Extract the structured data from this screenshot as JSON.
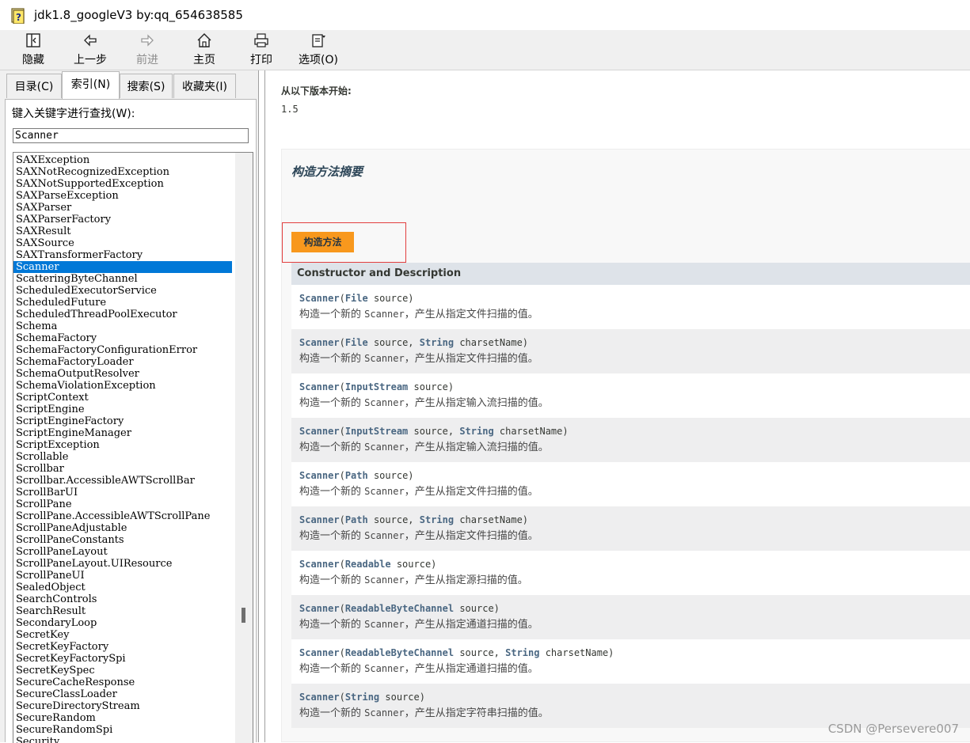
{
  "window": {
    "title": "jdk1.8_googleV3 by:qq_654638585"
  },
  "toolbar": {
    "hide": "隐藏",
    "back": "上一步",
    "forward": "前进",
    "home": "主页",
    "print": "打印",
    "options": "选项(O)"
  },
  "tabs": {
    "contents": "目录(C)",
    "index": "索引(N)",
    "search": "搜索(S)",
    "favorites": "收藏夹(I)"
  },
  "index_panel": {
    "search_label": "键入关键字进行查找(W):",
    "search_value": "Scanner",
    "selected": "Scanner",
    "items": [
      "SAXException",
      "SAXNotRecognizedException",
      "SAXNotSupportedException",
      "SAXParseException",
      "SAXParser",
      "SAXParserFactory",
      "SAXResult",
      "SAXSource",
      "SAXTransformerFactory",
      "Scanner",
      "ScatteringByteChannel",
      "ScheduledExecutorService",
      "ScheduledFuture",
      "ScheduledThreadPoolExecutor",
      "Schema",
      "SchemaFactory",
      "SchemaFactoryConfigurationError",
      "SchemaFactoryLoader",
      "SchemaOutputResolver",
      "SchemaViolationException",
      "ScriptContext",
      "ScriptEngine",
      "ScriptEngineFactory",
      "ScriptEngineManager",
      "ScriptException",
      "Scrollable",
      "Scrollbar",
      "Scrollbar.AccessibleAWTScrollBar",
      "ScrollBarUI",
      "ScrollPane",
      "ScrollPane.AccessibleAWTScrollPane",
      "ScrollPaneAdjustable",
      "ScrollPaneConstants",
      "ScrollPaneLayout",
      "ScrollPaneLayout.UIResource",
      "ScrollPaneUI",
      "SealedObject",
      "SearchControls",
      "SearchResult",
      "SecondaryLoop",
      "SecretKey",
      "SecretKeyFactory",
      "SecretKeyFactorySpi",
      "SecretKeySpec",
      "SecureCacheResponse",
      "SecureClassLoader",
      "SecureDirectoryStream",
      "SecureRandom",
      "SecureRandomSpi",
      "Security"
    ]
  },
  "content": {
    "since_label": "从以下版本开始:",
    "since_value": "1.5",
    "section_title": "构造方法摘要",
    "caption": "构造方法",
    "table_header": "Constructor and Description",
    "rows": [
      {
        "name": "Scanner",
        "open": "(",
        "type1": "File",
        "rest1": " source)",
        "type2": "",
        "rest2": "",
        "desc_pre": "构造一个新的 ",
        "desc_code": "Scanner",
        "desc_post": "，产生从指定文件扫描的值。"
      },
      {
        "name": "Scanner",
        "open": "(",
        "type1": "File",
        "rest1": " source, ",
        "type2": "String",
        "rest2": " charsetName)",
        "desc_pre": "构造一个新的 ",
        "desc_code": "Scanner",
        "desc_post": "，产生从指定文件扫描的值。"
      },
      {
        "name": "Scanner",
        "open": "(",
        "type1": "InputStream",
        "rest1": " source)",
        "type2": "",
        "rest2": "",
        "desc_pre": "构造一个新的 ",
        "desc_code": "Scanner",
        "desc_post": "，产生从指定输入流扫描的值。"
      },
      {
        "name": "Scanner",
        "open": "(",
        "type1": "InputStream",
        "rest1": " source, ",
        "type2": "String",
        "rest2": " charsetName)",
        "desc_pre": "构造一个新的 ",
        "desc_code": "Scanner",
        "desc_post": "，产生从指定输入流扫描的值。"
      },
      {
        "name": "Scanner",
        "open": "(",
        "type1": "Path",
        "rest1": " source)",
        "type2": "",
        "rest2": "",
        "desc_pre": "构造一个新的 ",
        "desc_code": "Scanner",
        "desc_post": "，产生从指定文件扫描的值。"
      },
      {
        "name": "Scanner",
        "open": "(",
        "type1": "Path",
        "rest1": " source, ",
        "type2": "String",
        "rest2": " charsetName)",
        "desc_pre": "构造一个新的 ",
        "desc_code": "Scanner",
        "desc_post": "，产生从指定文件扫描的值。"
      },
      {
        "name": "Scanner",
        "open": "(",
        "type1": "Readable",
        "rest1": " source)",
        "type2": "",
        "rest2": "",
        "desc_pre": "构造一个新的 ",
        "desc_code": "Scanner",
        "desc_post": "，产生从指定源扫描的值。"
      },
      {
        "name": "Scanner",
        "open": "(",
        "type1": "ReadableByteChannel",
        "rest1": " source)",
        "type2": "",
        "rest2": "",
        "desc_pre": "构造一个新的 ",
        "desc_code": "Scanner",
        "desc_post": "，产生从指定通道扫描的值。"
      },
      {
        "name": "Scanner",
        "open": "(",
        "type1": "ReadableByteChannel",
        "rest1": " source, ",
        "type2": "String",
        "rest2": " charsetName)",
        "desc_pre": "构造一个新的 ",
        "desc_code": "Scanner",
        "desc_post": "，产生从指定通道扫描的值。"
      },
      {
        "name": "Scanner",
        "open": "(",
        "type1": "String",
        "rest1": " source)",
        "type2": "",
        "rest2": "",
        "desc_pre": "构造一个新的 ",
        "desc_code": "Scanner",
        "desc_post": "，产生从指定字符串扫描的值。"
      }
    ]
  },
  "watermark": "CSDN @Persevere007",
  "colors": {
    "caption_bg": "#f8981d",
    "selection": "#0078d7",
    "header_bg": "#dee3e9",
    "highlight_border": "#e23e3e",
    "type_link": "#4a6782"
  }
}
